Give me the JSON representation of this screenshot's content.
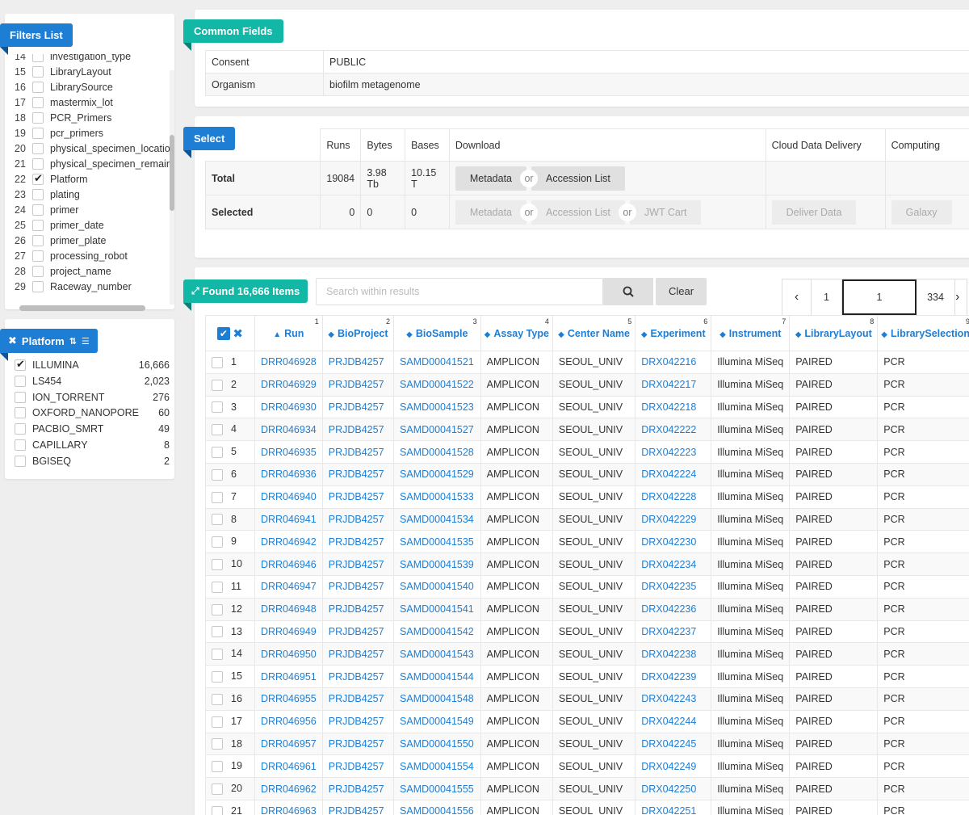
{
  "filters": {
    "title": "Filters List",
    "items": [
      {
        "n": "14",
        "label": "investigation_type",
        "checked": false
      },
      {
        "n": "15",
        "label": "LibraryLayout",
        "checked": false
      },
      {
        "n": "16",
        "label": "LibrarySource",
        "checked": false
      },
      {
        "n": "17",
        "label": "mastermix_lot",
        "checked": false
      },
      {
        "n": "18",
        "label": "PCR_Primers",
        "checked": false
      },
      {
        "n": "19",
        "label": "pcr_primers",
        "checked": false
      },
      {
        "n": "20",
        "label": "physical_specimen_locatio",
        "checked": false
      },
      {
        "n": "21",
        "label": "physical_specimen_remain",
        "checked": false
      },
      {
        "n": "22",
        "label": "Platform",
        "checked": true
      },
      {
        "n": "23",
        "label": "plating",
        "checked": false
      },
      {
        "n": "24",
        "label": "primer",
        "checked": false
      },
      {
        "n": "25",
        "label": "primer_date",
        "checked": false
      },
      {
        "n": "26",
        "label": "primer_plate",
        "checked": false
      },
      {
        "n": "27",
        "label": "processing_robot",
        "checked": false
      },
      {
        "n": "28",
        "label": "project_name",
        "checked": false
      },
      {
        "n": "29",
        "label": "Raceway_number",
        "checked": false
      }
    ]
  },
  "platform": {
    "title": "Platform",
    "items": [
      {
        "label": "ILLUMINA",
        "count": "16,666",
        "checked": true
      },
      {
        "label": "LS454",
        "count": "2,023",
        "checked": false
      },
      {
        "label": "ION_TORRENT",
        "count": "276",
        "checked": false
      },
      {
        "label": "OXFORD_NANOPORE",
        "count": "60",
        "checked": false
      },
      {
        "label": "PACBIO_SMRT",
        "count": "49",
        "checked": false
      },
      {
        "label": "CAPILLARY",
        "count": "8",
        "checked": false
      },
      {
        "label": "BGISEQ",
        "count": "2",
        "checked": false
      }
    ]
  },
  "common": {
    "title": "Common Fields",
    "rows": [
      {
        "key": "Consent",
        "value": "PUBLIC"
      },
      {
        "key": "Organism",
        "value": "biofilm metagenome"
      }
    ]
  },
  "select": {
    "title": "Select",
    "headers": {
      "runs": "Runs",
      "bytes": "Bytes",
      "bases": "Bases",
      "download": "Download",
      "cloud": "Cloud Data Delivery",
      "computing": "Computing"
    },
    "total": {
      "label": "Total",
      "runs": "19084",
      "bytes": "3.98 Tb",
      "bases": "10.15 T"
    },
    "selected": {
      "label": "Selected",
      "runs": "0",
      "bytes": "0",
      "bases": "0"
    },
    "buttons": {
      "metadata": "Metadata",
      "accession": "Accession List",
      "jwt": "JWT Cart",
      "deliver": "Deliver Data",
      "galaxy": "Galaxy",
      "or": "or"
    }
  },
  "results": {
    "title": "Found 16,666 Items",
    "search_placeholder": "Search within results",
    "clear": "Clear",
    "pager": {
      "first": "1",
      "current": "1",
      "last": "334"
    },
    "columns": [
      "Run",
      "BioProject",
      "BioSample",
      "Assay Type",
      "Center Name",
      "Experiment",
      "Instrument",
      "LibraryLayout",
      "LibrarySelection"
    ],
    "rows": [
      [
        "1",
        "DRR046928",
        "PRJDB4257",
        "SAMD00041521",
        "AMPLICON",
        "SEOUL_UNIV",
        "DRX042216",
        "Illumina MiSeq",
        "PAIRED",
        "PCR"
      ],
      [
        "2",
        "DRR046929",
        "PRJDB4257",
        "SAMD00041522",
        "AMPLICON",
        "SEOUL_UNIV",
        "DRX042217",
        "Illumina MiSeq",
        "PAIRED",
        "PCR"
      ],
      [
        "3",
        "DRR046930",
        "PRJDB4257",
        "SAMD00041523",
        "AMPLICON",
        "SEOUL_UNIV",
        "DRX042218",
        "Illumina MiSeq",
        "PAIRED",
        "PCR"
      ],
      [
        "4",
        "DRR046934",
        "PRJDB4257",
        "SAMD00041527",
        "AMPLICON",
        "SEOUL_UNIV",
        "DRX042222",
        "Illumina MiSeq",
        "PAIRED",
        "PCR"
      ],
      [
        "5",
        "DRR046935",
        "PRJDB4257",
        "SAMD00041528",
        "AMPLICON",
        "SEOUL_UNIV",
        "DRX042223",
        "Illumina MiSeq",
        "PAIRED",
        "PCR"
      ],
      [
        "6",
        "DRR046936",
        "PRJDB4257",
        "SAMD00041529",
        "AMPLICON",
        "SEOUL_UNIV",
        "DRX042224",
        "Illumina MiSeq",
        "PAIRED",
        "PCR"
      ],
      [
        "7",
        "DRR046940",
        "PRJDB4257",
        "SAMD00041533",
        "AMPLICON",
        "SEOUL_UNIV",
        "DRX042228",
        "Illumina MiSeq",
        "PAIRED",
        "PCR"
      ],
      [
        "8",
        "DRR046941",
        "PRJDB4257",
        "SAMD00041534",
        "AMPLICON",
        "SEOUL_UNIV",
        "DRX042229",
        "Illumina MiSeq",
        "PAIRED",
        "PCR"
      ],
      [
        "9",
        "DRR046942",
        "PRJDB4257",
        "SAMD00041535",
        "AMPLICON",
        "SEOUL_UNIV",
        "DRX042230",
        "Illumina MiSeq",
        "PAIRED",
        "PCR"
      ],
      [
        "10",
        "DRR046946",
        "PRJDB4257",
        "SAMD00041539",
        "AMPLICON",
        "SEOUL_UNIV",
        "DRX042234",
        "Illumina MiSeq",
        "PAIRED",
        "PCR"
      ],
      [
        "11",
        "DRR046947",
        "PRJDB4257",
        "SAMD00041540",
        "AMPLICON",
        "SEOUL_UNIV",
        "DRX042235",
        "Illumina MiSeq",
        "PAIRED",
        "PCR"
      ],
      [
        "12",
        "DRR046948",
        "PRJDB4257",
        "SAMD00041541",
        "AMPLICON",
        "SEOUL_UNIV",
        "DRX042236",
        "Illumina MiSeq",
        "PAIRED",
        "PCR"
      ],
      [
        "13",
        "DRR046949",
        "PRJDB4257",
        "SAMD00041542",
        "AMPLICON",
        "SEOUL_UNIV",
        "DRX042237",
        "Illumina MiSeq",
        "PAIRED",
        "PCR"
      ],
      [
        "14",
        "DRR046950",
        "PRJDB4257",
        "SAMD00041543",
        "AMPLICON",
        "SEOUL_UNIV",
        "DRX042238",
        "Illumina MiSeq",
        "PAIRED",
        "PCR"
      ],
      [
        "15",
        "DRR046951",
        "PRJDB4257",
        "SAMD00041544",
        "AMPLICON",
        "SEOUL_UNIV",
        "DRX042239",
        "Illumina MiSeq",
        "PAIRED",
        "PCR"
      ],
      [
        "16",
        "DRR046955",
        "PRJDB4257",
        "SAMD00041548",
        "AMPLICON",
        "SEOUL_UNIV",
        "DRX042243",
        "Illumina MiSeq",
        "PAIRED",
        "PCR"
      ],
      [
        "17",
        "DRR046956",
        "PRJDB4257",
        "SAMD00041549",
        "AMPLICON",
        "SEOUL_UNIV",
        "DRX042244",
        "Illumina MiSeq",
        "PAIRED",
        "PCR"
      ],
      [
        "18",
        "DRR046957",
        "PRJDB4257",
        "SAMD00041550",
        "AMPLICON",
        "SEOUL_UNIV",
        "DRX042245",
        "Illumina MiSeq",
        "PAIRED",
        "PCR"
      ],
      [
        "19",
        "DRR046961",
        "PRJDB4257",
        "SAMD00041554",
        "AMPLICON",
        "SEOUL_UNIV",
        "DRX042249",
        "Illumina MiSeq",
        "PAIRED",
        "PCR"
      ],
      [
        "20",
        "DRR046962",
        "PRJDB4257",
        "SAMD00041555",
        "AMPLICON",
        "SEOUL_UNIV",
        "DRX042250",
        "Illumina MiSeq",
        "PAIRED",
        "PCR"
      ],
      [
        "21",
        "DRR046963",
        "PRJDB4257",
        "SAMD00041556",
        "AMPLICON",
        "SEOUL_UNIV",
        "DRX042251",
        "Illumina MiSeq",
        "PAIRED",
        "PCR"
      ]
    ]
  },
  "colors": {
    "accent_blue": "#1e7ed4",
    "accent_teal": "#13b7a6"
  }
}
